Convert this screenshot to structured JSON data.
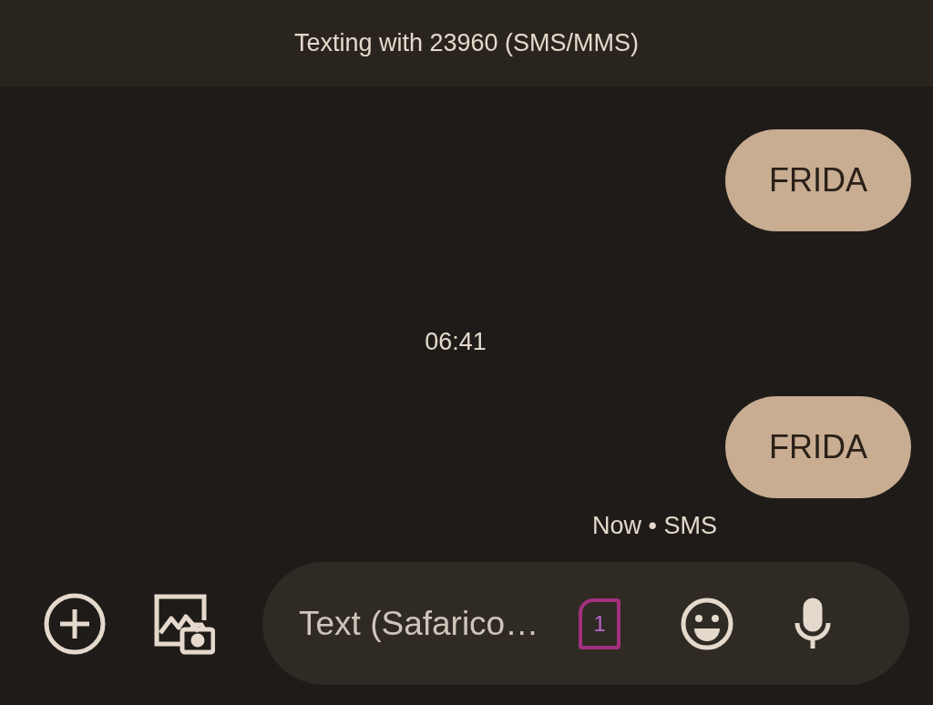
{
  "header": {
    "title": "Texting with 23960 (SMS/MMS)"
  },
  "messages": [
    {
      "kind": "bubble",
      "text": "FRIDA"
    },
    {
      "kind": "time",
      "text": "06:41"
    },
    {
      "kind": "bubble",
      "text": "FRIDA"
    },
    {
      "kind": "status",
      "text": "Now • SMS"
    }
  ],
  "compose": {
    "placeholder": "Text (Safarico…",
    "sim": "1"
  }
}
